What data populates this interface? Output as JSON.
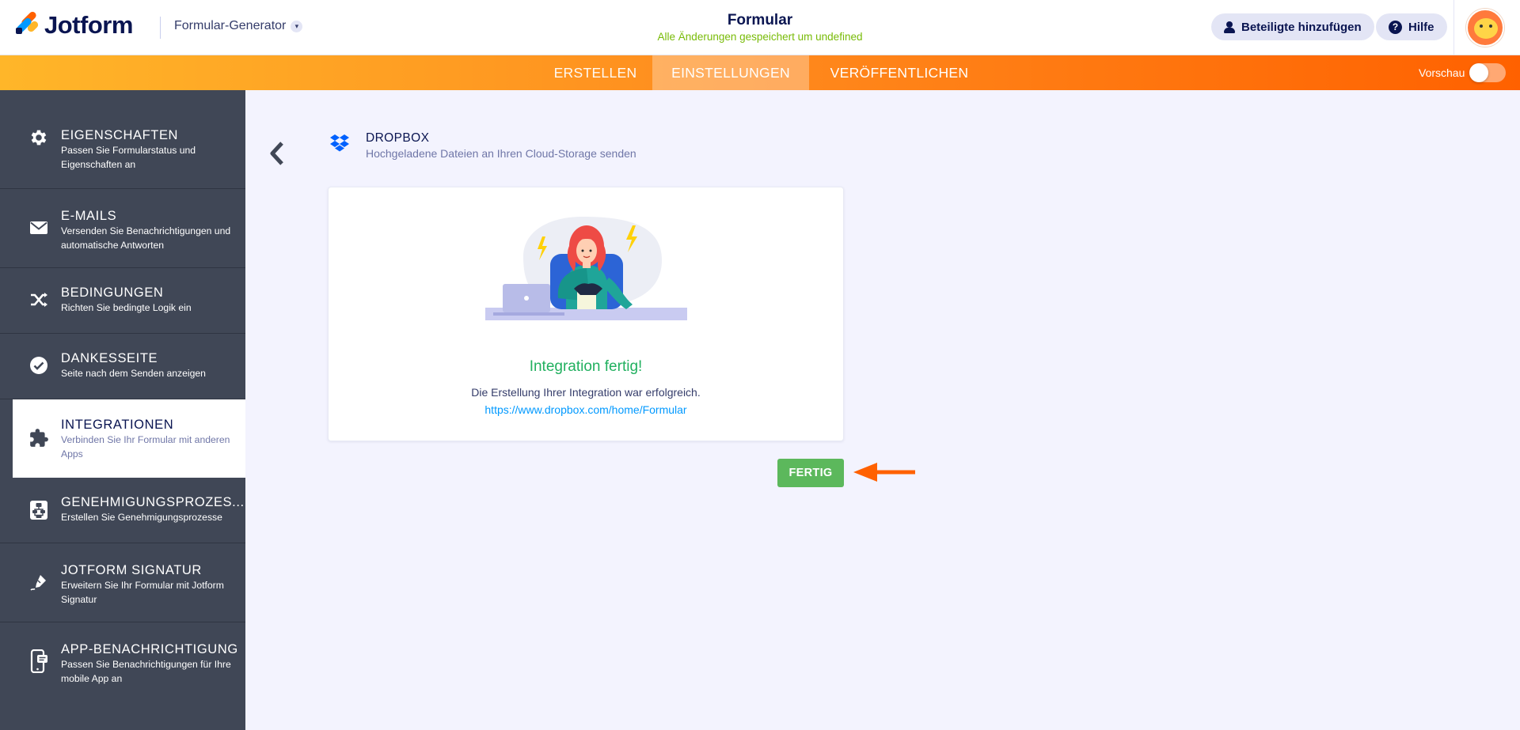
{
  "header": {
    "logo_text": "Jotform",
    "generator_label": "Formular-Generator",
    "form_title": "Formular",
    "save_status": "Alle Änderungen gespeichert um undefined",
    "add_participants_label": "Beteiligte hinzufügen",
    "help_label": "Hilfe",
    "icons": [
      "user-icon",
      "help-icon",
      "chevron-down-icon"
    ]
  },
  "navbar": {
    "tabs": [
      {
        "label": "ERSTELLEN",
        "active": false
      },
      {
        "label": "EINSTELLUNGEN",
        "active": true
      },
      {
        "label": "VERÖFFENTLICHEN",
        "active": false
      }
    ],
    "preview_label": "Vorschau",
    "preview_enabled": false
  },
  "sidebar": {
    "items": [
      {
        "title": "EIGENSCHAFTEN",
        "desc": "Passen Sie Formularstatus und Eigenschaften an",
        "icon": "gear-icon",
        "active": false
      },
      {
        "title": "E-MAILS",
        "desc": "Versenden Sie Benachrichtigungen und automatische Antworten",
        "icon": "envelope-icon",
        "active": false
      },
      {
        "title": "BEDINGUNGEN",
        "desc": "Richten Sie bedingte Logik ein",
        "icon": "shuffle-icon",
        "active": false
      },
      {
        "title": "DANKESSEITE",
        "desc": "Seite nach dem Senden anzeigen",
        "icon": "check-circle-icon",
        "active": false
      },
      {
        "title": "INTEGRATIONEN",
        "desc": "Verbinden Sie Ihr Formular mit anderen Apps",
        "icon": "puzzle-icon",
        "active": true
      },
      {
        "title": "GENEHMIGUNGSPROZES...",
        "desc": "Erstellen Sie Genehmigungsprozesse",
        "icon": "workflow-icon",
        "active": false
      },
      {
        "title": "JOTFORM SIGNATUR",
        "desc": "Erweitern Sie Ihr Formular mit Jotform Signatur",
        "icon": "signature-pen-icon",
        "active": false
      },
      {
        "title": "APP-BENACHRICHTIGUNG",
        "desc": "Passen Sie Benachrichtigungen für Ihre mobile App an",
        "icon": "mobile-notification-icon",
        "active": false
      }
    ]
  },
  "integration": {
    "name": "DROPBOX",
    "subtitle": "Hochgeladene Dateien an Ihren Cloud-Storage senden",
    "icon": "dropbox-icon",
    "success_title": "Integration fertig!",
    "success_text": "Die Erstellung Ihrer Integration war erfolgreich.",
    "success_link": "https://www.dropbox.com/home/Formular",
    "done_label": "FERTIG"
  },
  "colors": {
    "accent_orange": "#ff6100",
    "success_green": "#21b05f",
    "done_button": "#5cb85c",
    "sidebar_bg": "#404756",
    "link_blue": "#0099ff"
  }
}
